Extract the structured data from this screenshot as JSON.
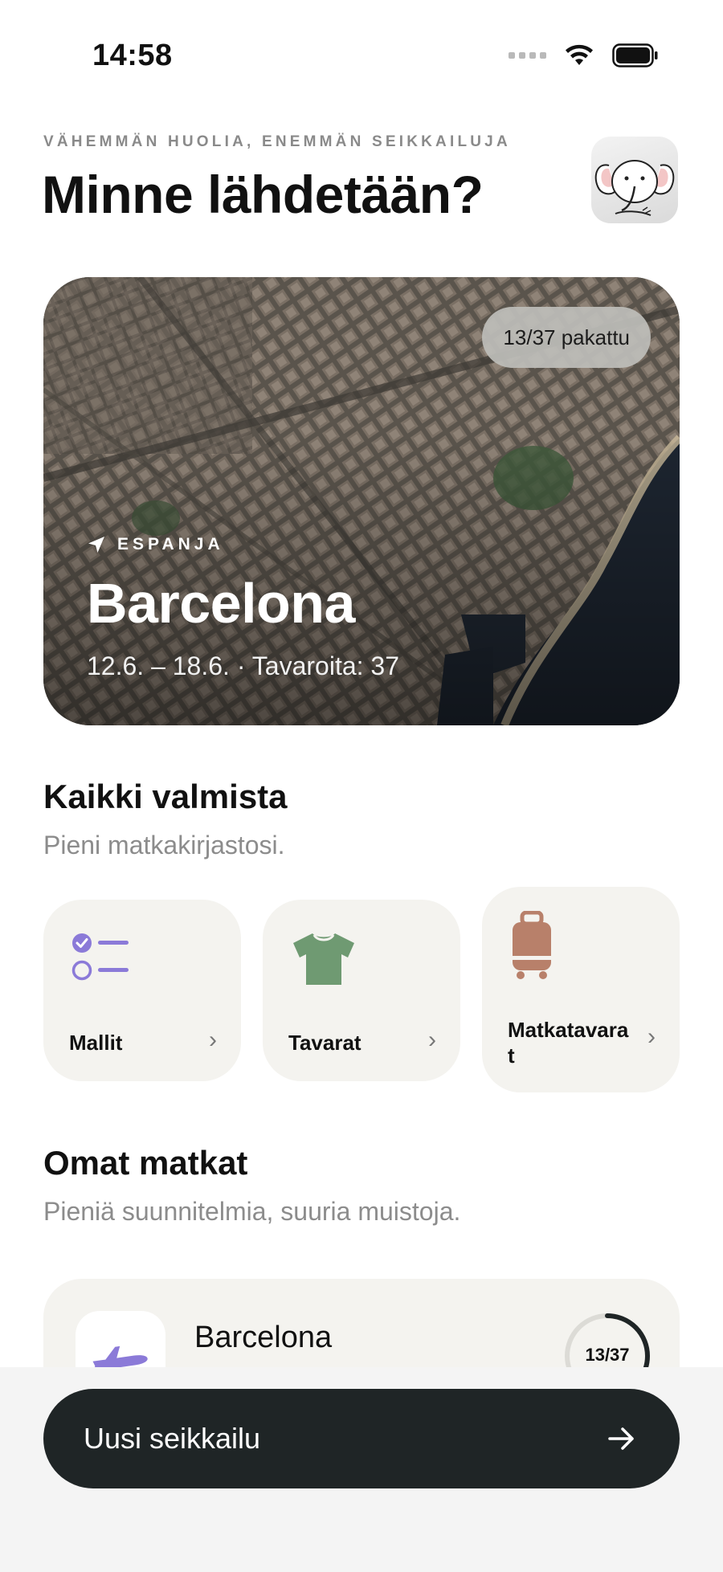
{
  "status_bar": {
    "time": "14:58"
  },
  "header": {
    "eyebrow": "VÄHEMMÄN HUOLIA, ENEMMÄN SEIKKAILUJA",
    "title": "Minne lähdetään?"
  },
  "featured_trip": {
    "badge": "13/37 pakattu",
    "packed": 13,
    "total": 37,
    "country": "ESPANJA",
    "city": "Barcelona",
    "meta": "12.6. – 18.6. · Tavaroita: 37"
  },
  "ready_section": {
    "title": "Kaikki valmista",
    "subtitle": "Pieni matkakirjastosi.",
    "tiles": [
      {
        "label": "Mallit",
        "icon": "checklist-icon",
        "color": "#8b7ad8"
      },
      {
        "label": "Tavarat",
        "icon": "tshirt-icon",
        "color": "#6f9a72"
      },
      {
        "label": "Matkatavara\nt",
        "icon": "suitcase-icon",
        "color": "#b8806a"
      }
    ]
  },
  "trips_section": {
    "title": "Omat matkat",
    "subtitle": "Pieniä suunnitelmia, suuria muistoja.",
    "trips": [
      {
        "name": "Barcelona",
        "progress_label": "13/37",
        "packed": 13,
        "total": 37,
        "icon": "airplane-icon"
      }
    ]
  },
  "cta": {
    "label": "Uusi seikkailu",
    "icon": "arrow-right-icon"
  },
  "colors": {
    "accent_purple": "#8b7ad8",
    "accent_green": "#6f9a72",
    "accent_brown": "#b8806a",
    "cta_background": "#1f2526",
    "card_background": "#f4f3ef"
  }
}
